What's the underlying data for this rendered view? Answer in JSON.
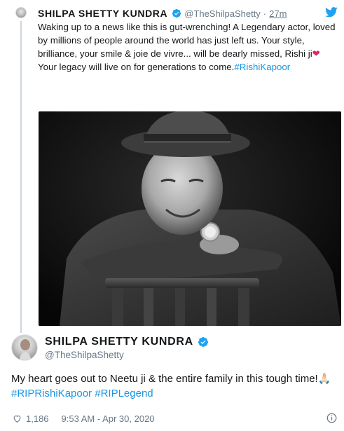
{
  "quoted": {
    "name": "SHILPA SHETTY KUNDRA",
    "handle": "@TheShilpaShetty",
    "separator": "·",
    "time": "27m",
    "text_main": "Waking up to a news like this is gut-wrenching! A Legendary actor, loved by millions of people around the world has just left us. Your style, brilliance, your smile & joie de vivre... will be dearly missed, Rishi ji",
    "heart": "❤",
    "text_after": " Your legacy will live on for generations to come.",
    "hashtag": "#RishiKapoor",
    "verified_icon": "verified-badge-icon",
    "platform_icon": "twitter-bird-icon"
  },
  "main": {
    "name": "SHILPA SHETTY KUNDRA",
    "handle": "@TheShilpaShetty",
    "text": "My heart goes out to Neetu ji & the entire family in this tough time!",
    "emoji": "🙏🏻",
    "hashtag1": "#RIPRishiKapoor",
    "hashtag2": "#RIPLegend",
    "likes": "1,186",
    "timestamp": "9:53 AM - Apr 30, 2020"
  },
  "colors": {
    "link": "#1b95e0",
    "verified": "#1da1f2",
    "heart": "#e0245e",
    "muted": "#657786"
  }
}
